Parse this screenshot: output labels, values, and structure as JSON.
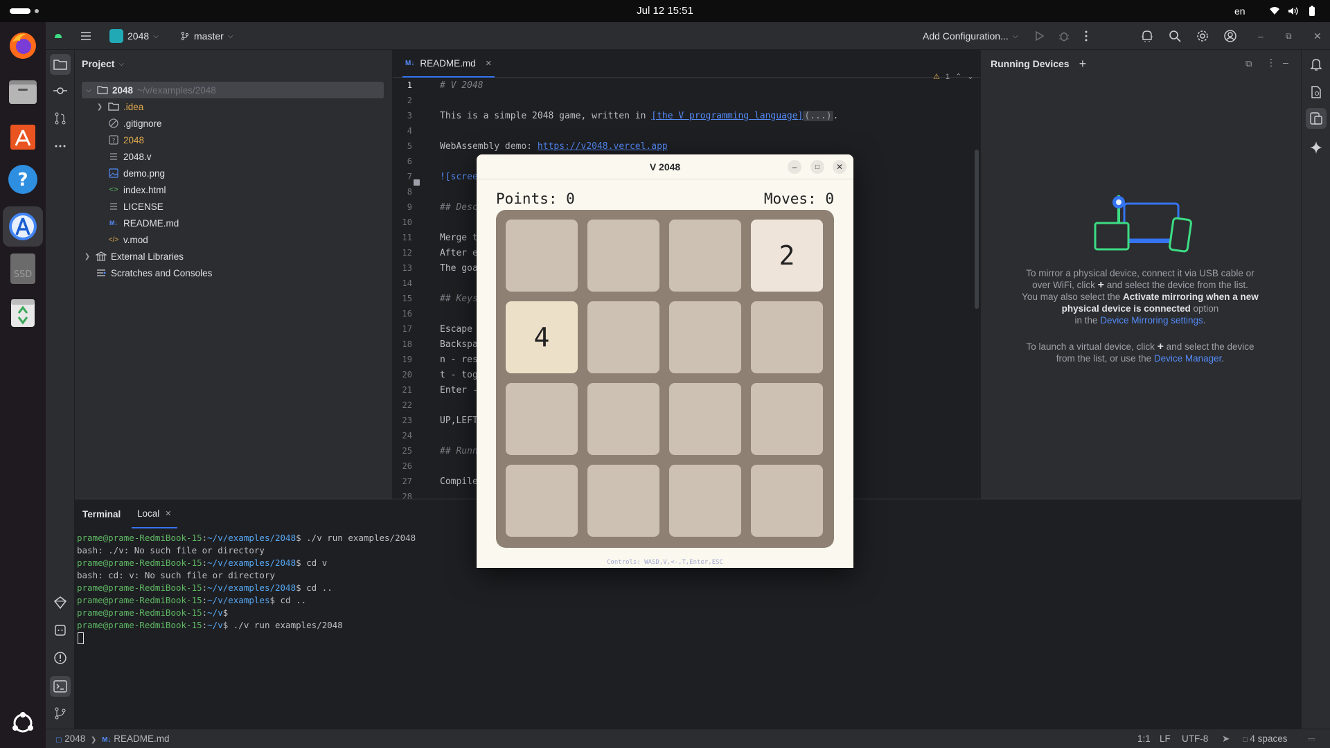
{
  "system": {
    "clock": "Jul 12  15:51",
    "language": "en"
  },
  "toolbar": {
    "project_name": "2048",
    "branch": "master",
    "run_config": "Add Configuration..."
  },
  "project_panel": {
    "title": "Project",
    "root_name": "2048",
    "root_path": "~/v/examples/2048",
    "items": [
      {
        "label": "2048",
        "icon": "folder-icon",
        "color": "#dfe1e5"
      },
      {
        "label": ".idea",
        "icon": "folder-icon",
        "color": "#e0a94f"
      },
      {
        "label": ".gitignore",
        "icon": "ignore-file-icon",
        "color": "#dfe1e5"
      },
      {
        "label": "2048",
        "icon": "unknown-file-icon",
        "color": "#e0a94f"
      },
      {
        "label": "2048.v",
        "icon": "text-file-icon",
        "color": "#dfe1e5"
      },
      {
        "label": "demo.png",
        "icon": "image-file-icon",
        "color": "#dfe1e5"
      },
      {
        "label": "index.html",
        "icon": "html-file-icon",
        "color": "#dfe1e5"
      },
      {
        "label": "LICENSE",
        "icon": "text-file-icon",
        "color": "#dfe1e5"
      },
      {
        "label": "README.md",
        "icon": "markdown-file-icon",
        "color": "#dfe1e5"
      },
      {
        "label": "v.mod",
        "icon": "module-file-icon",
        "color": "#dfe1e5"
      },
      {
        "label": "External Libraries",
        "icon": "library-icon",
        "color": "#dfe1e5"
      },
      {
        "label": "Scratches and Consoles",
        "icon": "scratches-icon",
        "color": "#dfe1e5"
      }
    ]
  },
  "editor": {
    "tab_icon": "M↓",
    "tab_label": "README.md",
    "warning_count": "1",
    "line_numbers": [
      "1",
      "2",
      "3",
      "4",
      "5",
      "6",
      "7",
      "8",
      "9",
      "10",
      "11",
      "12",
      "13",
      "14",
      "15",
      "16",
      "17",
      "18",
      "19",
      "20",
      "21",
      "22",
      "23",
      "24",
      "25",
      "26",
      "27",
      "28"
    ],
    "lines": {
      "l1": "# V 2048",
      "l3_pre": "This is a simple 2048 game, written in ",
      "l3_link": "[the V programming language]",
      "l3_fold": "(...)",
      "l3_post": ".",
      "l5_pre": "WebAssembly demo: ",
      "l5_link": "https://v2048.vercel.app",
      "l7": "![scree",
      "l9": "## Desc",
      "l11": "Merge t",
      "l12": "After e",
      "l13": "The goa",
      "l15": "## Keys",
      "l17": "Escape ",
      "l18": "Backspa",
      "l19": "n - res",
      "l20": "t - tog",
      "l21": "Enter -",
      "l23": "UP,LEFT",
      "l25": "## Runn",
      "l27": "Compile"
    }
  },
  "devices_panel": {
    "title": "Running Devices",
    "physical_1": "To mirror a physical device, connect it via USB cable or",
    "physical_2a": "over WiFi, click ",
    "physical_2b": " and select the device from the list.",
    "physical_3a": "You may also select the ",
    "physical_3b": "Activate mirroring when a new",
    "physical_4a": "physical device is connected",
    "physical_4b": " option",
    "physical_5a": "in the ",
    "physical_5b": "Device Mirroring settings",
    "physical_5c": ".",
    "virtual_1a": "To launch a virtual device, click ",
    "virtual_1b": " and select the device",
    "virtual_2a": "from the list, or use the ",
    "virtual_2b": "Device Manager",
    "virtual_2c": "."
  },
  "terminal": {
    "tab_title": "Terminal",
    "tab_local": "Local",
    "lines": [
      {
        "user": "prame@prame-RedmiBook-15",
        "path": "~/v/examples/2048",
        "cmd": "$ ./v run examples/2048"
      },
      {
        "text": "bash: ./v: No such file or directory"
      },
      {
        "user": "prame@prame-RedmiBook-15",
        "path": "~/v/examples/2048",
        "cmd": "$ cd v"
      },
      {
        "text": "bash: cd: v: No such file or directory"
      },
      {
        "user": "prame@prame-RedmiBook-15",
        "path": "~/v/examples/2048",
        "cmd": "$ cd .."
      },
      {
        "user": "prame@prame-RedmiBook-15",
        "path": "~/v/examples",
        "cmd": "$ cd .."
      },
      {
        "user": "prame@prame-RedmiBook-15",
        "path": "~/v",
        "cmd": "$"
      },
      {
        "user": "prame@prame-RedmiBook-15",
        "path": "~/v",
        "cmd": "$ ./v run examples/2048"
      }
    ]
  },
  "statusbar": {
    "crumb_project": "2048",
    "crumb_file_icon": "M↓",
    "crumb_file": "README.md",
    "position": "1:1",
    "line_ending": "LF",
    "encoding": "UTF-8",
    "indent": "4 spaces"
  },
  "game": {
    "window_title": "V 2048",
    "points": "Points: 0",
    "moves": "Moves: 0",
    "board": [
      [
        "",
        "",
        "",
        "2"
      ],
      [
        "4",
        "",
        "",
        ""
      ],
      [
        "",
        "",
        "",
        ""
      ],
      [
        "",
        "",
        "",
        ""
      ]
    ],
    "controls_hint": "Controls: WASD,V,<-,T,Enter,ESC",
    "colors": {
      "empty": "#cdc1b4",
      "tile_2": "#eee4da",
      "tile_4": "#ede0c8",
      "board": "#8e8073"
    }
  },
  "colors": {
    "accent": "#3574f0",
    "link": "#548af7",
    "terminal_user": "#5fb865",
    "terminal_path": "#56a8f5"
  }
}
